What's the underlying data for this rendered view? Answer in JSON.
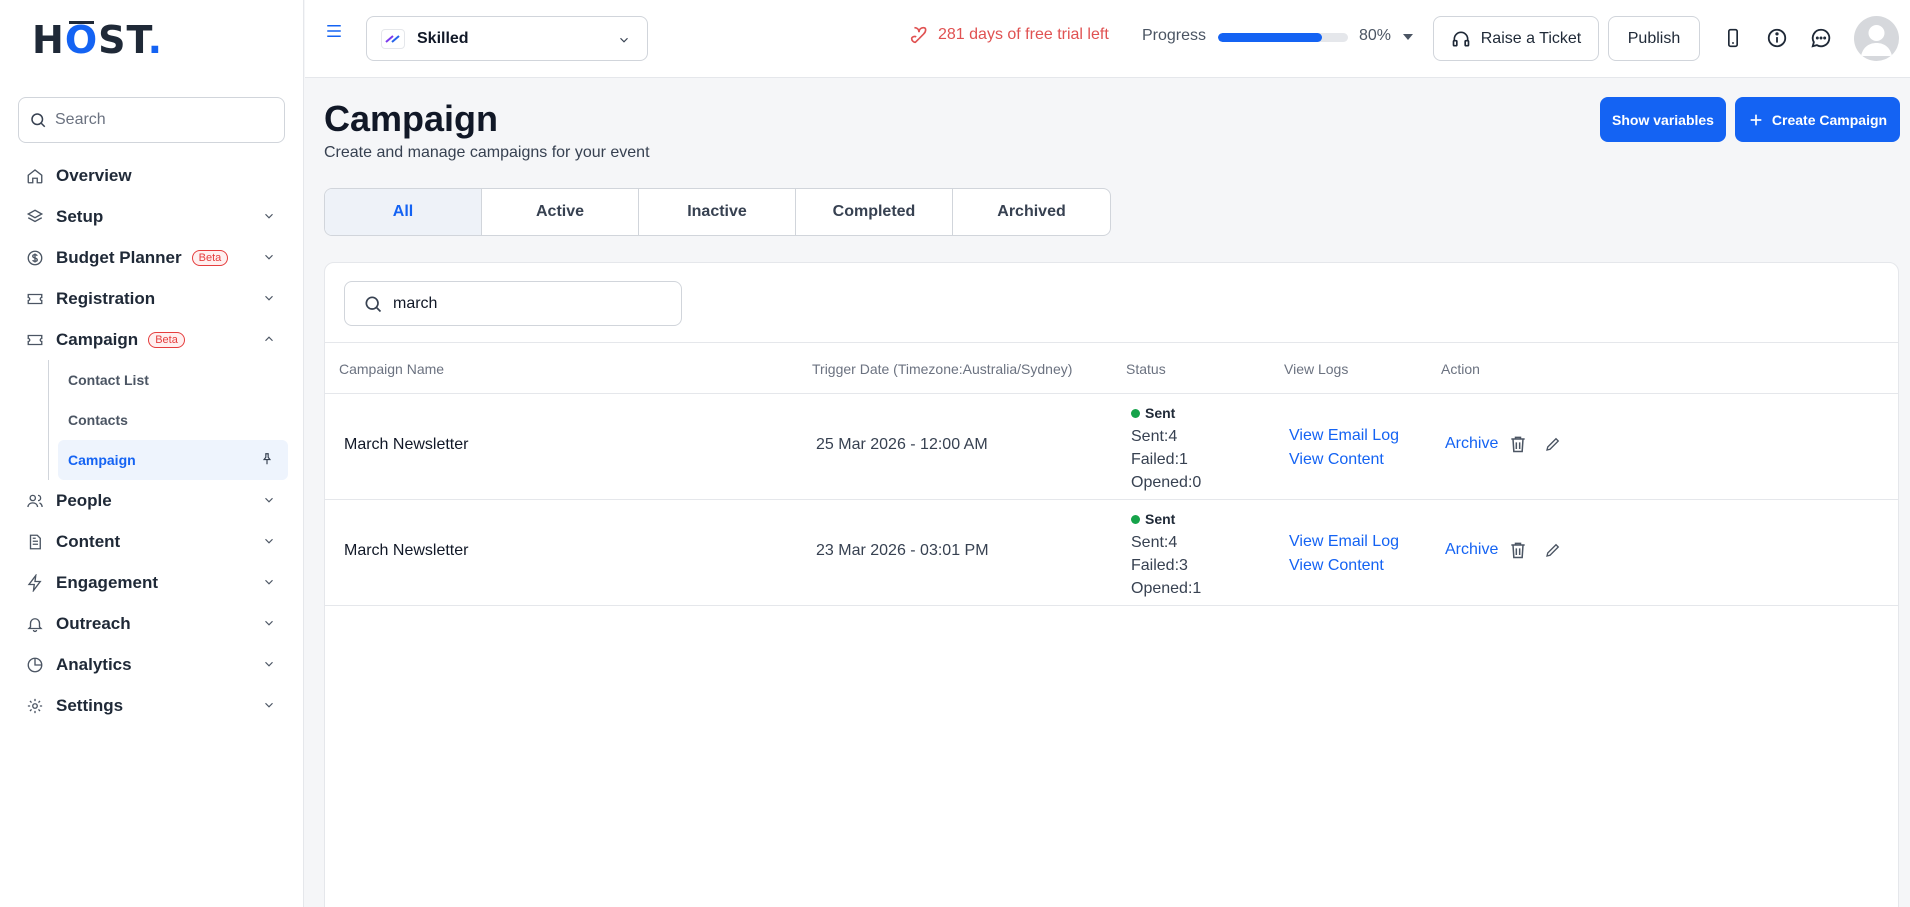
{
  "brand": {
    "logo_text_1": "H",
    "logo_text_2": "O",
    "logo_text_3": "ST",
    "logo_dot": ".",
    "accent": "#1463f3"
  },
  "sidebar": {
    "search_placeholder": "Search",
    "items": [
      {
        "label": "Overview",
        "icon": "home-icon"
      },
      {
        "label": "Setup",
        "icon": "layers-icon"
      },
      {
        "label": "Budget Planner",
        "icon": "dollar-icon",
        "badge": "Beta"
      },
      {
        "label": "Registration",
        "icon": "ticket-icon"
      },
      {
        "label": "Campaign",
        "icon": "ticket-icon",
        "badge": "Beta",
        "expanded": true
      },
      {
        "label": "People",
        "icon": "people-icon"
      },
      {
        "label": "Content",
        "icon": "document-icon"
      },
      {
        "label": "Engagement",
        "icon": "lightning-icon"
      },
      {
        "label": "Outreach",
        "icon": "bell-icon"
      },
      {
        "label": "Analytics",
        "icon": "pie-chart-icon"
      },
      {
        "label": "Settings",
        "icon": "gear-icon"
      }
    ],
    "campaign_sub": [
      {
        "label": "Contact List"
      },
      {
        "label": "Contacts"
      },
      {
        "label": "Campaign",
        "active": true
      }
    ]
  },
  "topbar": {
    "event_name": "Skilled",
    "trial_text": "281 days of free trial left",
    "progress_label": "Progress",
    "progress_value": "80%",
    "progress_fraction": 0.8,
    "raise_ticket": "Raise a Ticket",
    "publish": "Publish"
  },
  "main": {
    "title": "Campaign",
    "subtitle": "Create and manage campaigns for your event",
    "show_variables": "Show variables",
    "create_campaign": "Create Campaign",
    "tabs": [
      "All",
      "Active",
      "Inactive",
      "Completed",
      "Archived"
    ],
    "active_tab": "All",
    "search_value": "march",
    "columns": [
      "Campaign Name",
      "Trigger Date (Timezone:Australia/Sydney)",
      "Status",
      "View Logs",
      "Action"
    ],
    "rows": [
      {
        "name": "March Newsletter",
        "date": "25 Mar 2026 - 12:00 AM",
        "status": "Sent",
        "sent": "Sent:4",
        "failed": "Failed:1",
        "opened": "Opened:0",
        "log_link": "View Email Log",
        "content_link": "View Content",
        "archive": "Archive"
      },
      {
        "name": "March Newsletter",
        "date": "23 Mar 2026 - 03:01 PM",
        "status": "Sent",
        "sent": "Sent:4",
        "failed": "Failed:3",
        "opened": "Opened:1",
        "log_link": "View Email Log",
        "content_link": "View Content",
        "archive": "Archive"
      }
    ]
  }
}
